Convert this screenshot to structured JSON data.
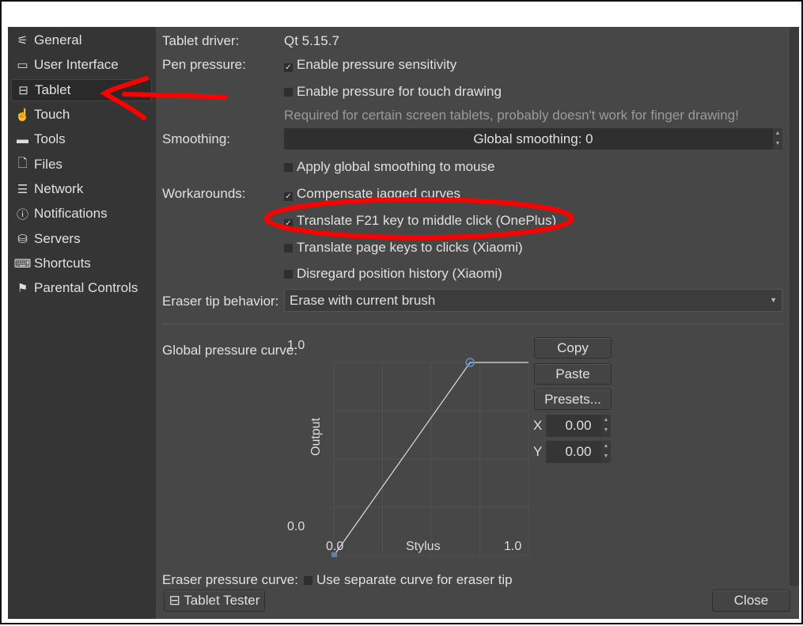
{
  "sidebar": {
    "items": [
      {
        "label": "General",
        "icon": "sliders-icon"
      },
      {
        "label": "User Interface",
        "icon": "window-icon"
      },
      {
        "label": "Tablet",
        "icon": "tablet-icon",
        "selected": true
      },
      {
        "label": "Touch",
        "icon": "touch-icon"
      },
      {
        "label": "Tools",
        "icon": "toolbox-icon"
      },
      {
        "label": "Files",
        "icon": "file-icon"
      },
      {
        "label": "Network",
        "icon": "network-icon"
      },
      {
        "label": "Notifications",
        "icon": "notification-icon"
      },
      {
        "label": "Servers",
        "icon": "database-icon"
      },
      {
        "label": "Shortcuts",
        "icon": "keyboard-icon"
      },
      {
        "label": "Parental Controls",
        "icon": "flag-icon"
      }
    ]
  },
  "main": {
    "tablet_driver_label": "Tablet driver:",
    "tablet_driver_value": "Qt 5.15.7",
    "pen_pressure_label": "Pen pressure:",
    "enable_pressure": {
      "label": "Enable pressure sensitivity",
      "checked": true
    },
    "enable_touch_pressure": {
      "label": "Enable pressure for touch drawing",
      "checked": false
    },
    "touch_hint": "Required for certain screen tablets, probably doesn't work for finger drawing!",
    "smoothing_label": "Smoothing:",
    "smoothing_value": "Global smoothing: 0",
    "apply_smoothing_mouse": {
      "label": "Apply global smoothing to mouse",
      "checked": false
    },
    "workarounds_label": "Workarounds:",
    "workarounds": [
      {
        "label": "Compensate jagged curves",
        "checked": true
      },
      {
        "label": "Translate F21 key to middle click (OnePlus)",
        "checked": true
      },
      {
        "label": "Translate page keys to clicks (Xiaomi)",
        "checked": false
      },
      {
        "label": "Disregard position history (Xiaomi)",
        "checked": false
      }
    ],
    "eraser_tip_label": "Eraser tip behavior:",
    "eraser_tip_value": "Erase with current brush",
    "pressure_curve_label": "Global pressure curve:",
    "eraser_curve_label": "Eraser pressure curve:",
    "eraser_curve_checkbox": {
      "label": "Use separate curve for eraser tip",
      "checked": false
    },
    "copy": "Copy",
    "paste": "Paste",
    "presets": "Presets...",
    "x_label": "X",
    "x_value": "0.00",
    "y_label": "Y",
    "y_value": "0.00",
    "tablet_tester": "Tablet Tester",
    "close": "Close"
  },
  "chart_data": {
    "type": "line",
    "xlabel": "Stylus",
    "ylabel": "Output",
    "xlim": [
      0,
      1
    ],
    "ylim": [
      0,
      1
    ],
    "x_ticks": [
      "0.0",
      "1.0"
    ],
    "y_ticks": [
      "0.0",
      "1.0"
    ],
    "points": [
      [
        0,
        0
      ],
      [
        0.7,
        1.0
      ],
      [
        1.0,
        1.0
      ]
    ]
  },
  "colors": {
    "annotation": "#ff0000",
    "handle": "#5b84b1"
  }
}
